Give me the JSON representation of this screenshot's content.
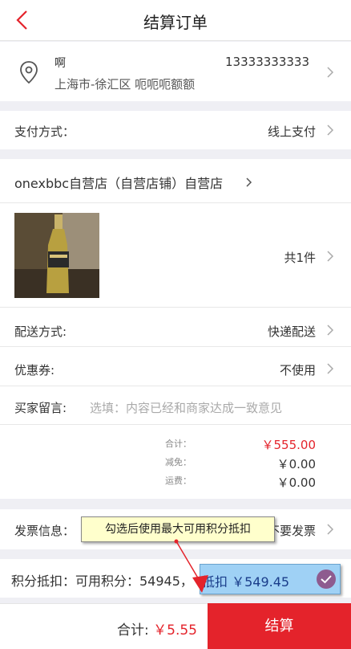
{
  "header": {
    "title": "结算订单",
    "back_icon": "back-chevron-icon"
  },
  "address": {
    "name": "啊",
    "phone": "13333333333",
    "detail": "上海市-徐汇区  呃呃呃额额",
    "icon": "location-pin-icon"
  },
  "payment": {
    "label": "支付方式：",
    "value": "线上支付"
  },
  "store": {
    "name": "onexbbc自营店（自营店铺）自营店"
  },
  "product": {
    "count_text": "共1件"
  },
  "delivery": {
    "label": "配送方式:",
    "value": "快递配送"
  },
  "coupon": {
    "label": "优惠券:",
    "value": "不使用"
  },
  "message": {
    "label": "买家留言:",
    "placeholder": "选填：内容已经和商家达成一致意见"
  },
  "summary": {
    "total_label": "合计：",
    "total_value": "￥555.00",
    "discount_label": "减免：",
    "discount_value": "￥0.00",
    "shipping_label": "运费：",
    "shipping_value": "￥0.00"
  },
  "invoice": {
    "label": "发票信息：",
    "value": "不要发票"
  },
  "tooltip": {
    "text": "勾选后使用最大可用积分抵扣"
  },
  "points": {
    "label": "积分抵扣：可用积分：54945，",
    "deduct_text": "抵扣 ￥549.45",
    "checked": true
  },
  "footer": {
    "total_label": "合计: ",
    "total_value": "￥5.55",
    "submit_label": "结算"
  },
  "colors": {
    "accent": "#e4232b",
    "check": "#8e5b8f",
    "highlight": "#9fd1f5"
  }
}
